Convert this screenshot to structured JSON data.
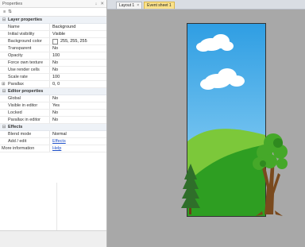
{
  "panel": {
    "title": "Properties",
    "pin_icon": "pin-icon",
    "close_icon": "close-icon"
  },
  "toolbar": {
    "categorized_icon": "categorized-icon",
    "sort_icon": "sort-az-icon"
  },
  "layer_properties": {
    "label": "Layer properties",
    "rows": [
      {
        "name": "Name",
        "value": "Background"
      },
      {
        "name": "Initial visibility",
        "value": "Visible"
      },
      {
        "name": "Background color",
        "value": "255, 255, 255"
      },
      {
        "name": "Transparent",
        "value": "No"
      },
      {
        "name": "Opacity",
        "value": "100"
      },
      {
        "name": "Force own texture",
        "value": "No"
      },
      {
        "name": "Use render cells",
        "value": "No"
      },
      {
        "name": "Scale rate",
        "value": "100"
      },
      {
        "name": "Parallax",
        "value": "0, 0"
      }
    ]
  },
  "editor_properties": {
    "label": "Editor properties",
    "rows": [
      {
        "name": "Global",
        "value": "No"
      },
      {
        "name": "Visible in editor",
        "value": "Yes"
      },
      {
        "name": "Locked",
        "value": "No"
      },
      {
        "name": "Parallax in editor",
        "value": "No"
      }
    ]
  },
  "effects": {
    "label": "Effects",
    "rows": [
      {
        "name": "Blend mode",
        "value": "Normal"
      },
      {
        "name": "Add / edit",
        "value": "Effects"
      }
    ]
  },
  "more_information": {
    "name": "More information",
    "value": "Help"
  },
  "tabs": [
    {
      "label": "Layout 1"
    },
    {
      "label": "Event sheet 1"
    }
  ],
  "colors": {
    "sky": "#3aa7e6",
    "hill_far": "#7cc83a",
    "hill_near": "#2e9e22",
    "tree_leaves": "#45a829",
    "trunk": "#7a4a1e",
    "canvas_bg": "#a8a8a8",
    "active_tab": "#fbe28b"
  }
}
